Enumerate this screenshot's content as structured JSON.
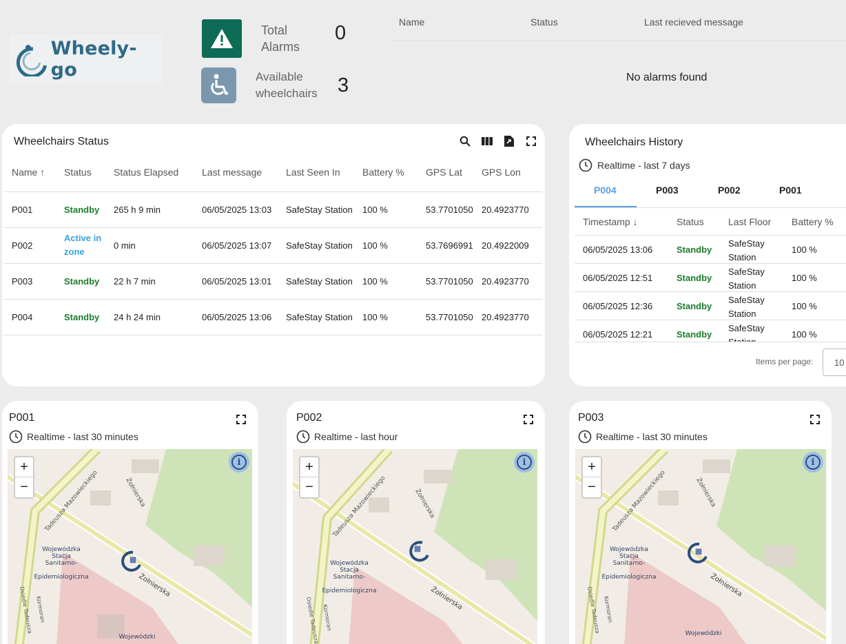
{
  "app": {
    "logo_text": "Wheely-go"
  },
  "kpis": {
    "alarms_label": "Total Alarms",
    "alarms_label_l1": "Total",
    "alarms_label_l2": "Alarms",
    "alarms_value": "0",
    "wheelchairs_label_l1": "Available",
    "wheelchairs_label_l2": "wheelchairs",
    "wheelchairs_value": "3"
  },
  "alarms_table": {
    "columns": [
      "Name",
      "Status",
      "Last recieved message"
    ],
    "empty_text": "No alarms found"
  },
  "status_panel": {
    "title": "Wheelchairs Status",
    "columns": [
      "Name",
      "Status",
      "Status Elapsed",
      "Last message",
      "Last Seen In",
      "Battery %",
      "GPS Lat",
      "GPS Lon"
    ],
    "sort_column": "Name",
    "rows": [
      {
        "name": "P001",
        "status": "Standby",
        "elapsed": "265 h 9 min",
        "last_message": "06/05/2025 13:03",
        "last_seen": "SafeStay Station",
        "battery": "100 %",
        "lat": "53.7701050",
        "lon": "20.4923770"
      },
      {
        "name": "P002",
        "status_l1": "Active in",
        "status_l2": "zone",
        "elapsed": "0 min",
        "last_message": "06/05/2025 13:07",
        "last_seen": "SafeStay Station",
        "battery": "100 %",
        "lat": "53.7696991",
        "lon": "20.4922009"
      },
      {
        "name": "P003",
        "status": "Standby",
        "elapsed": "22 h 7 min",
        "last_message": "06/05/2025 13:01",
        "last_seen": "SafeStay Station",
        "battery": "100 %",
        "lat": "53.7701050",
        "lon": "20.4923770"
      },
      {
        "name": "P004",
        "status": "Standby",
        "elapsed": "24 h 24 min",
        "last_message": "06/05/2025 13:06",
        "last_seen": "SafeStay Station",
        "battery": "100 %",
        "lat": "53.7701050",
        "lon": "20.4923770"
      }
    ],
    "status_colors": {
      "standby": "#1b7c2c",
      "active": "#3aa0dc"
    }
  },
  "history_panel": {
    "title": "Wheelchairs History",
    "range": "Realtime - last 7 days",
    "tabs": [
      "P004",
      "P003",
      "P002",
      "P001"
    ],
    "active_tab": "P004",
    "columns": [
      "Timestamp",
      "Status",
      "Last Floor",
      "Battery %"
    ],
    "rows": [
      {
        "timestamp": "06/05/2025 13:06",
        "status": "Standby",
        "floor_l1": "SafeStay",
        "floor_l2": "Station",
        "battery": "100 %"
      },
      {
        "timestamp": "06/05/2025 12:51",
        "status": "Standby",
        "floor_l1": "SafeStay",
        "floor_l2": "Station",
        "battery": "100 %"
      },
      {
        "timestamp": "06/05/2025 12:36",
        "status": "Standby",
        "floor_l1": "SafeStay",
        "floor_l2": "Station",
        "battery": "100 %"
      },
      {
        "timestamp": "06/05/2025 12:21",
        "status": "Standby",
        "floor_l1": "SafeStay",
        "floor_l2": "Station",
        "battery": "100 %"
      }
    ],
    "pager_label": "Items per page:",
    "pager_value": "10"
  },
  "maps": [
    {
      "title": "P001",
      "range": "Realtime - last 30 minutes"
    },
    {
      "title": "P002",
      "range": "Realtime - last hour"
    },
    {
      "title": "P003",
      "range": "Realtime - last 30 minutes"
    }
  ],
  "map_labels": {
    "street_1": "Tadeusza Mazowieckiego",
    "street_2": "Żołnierska",
    "street_3": "Osiedle Tadeusza",
    "street_4": "Kormoran",
    "poi_l1": "Wojewódzka",
    "poi_l2": "Stacja",
    "poi_l3": "Sanitarno-",
    "poi_l4": "Epidemiologiczna",
    "poi_bottom": "Wojewódzki"
  }
}
